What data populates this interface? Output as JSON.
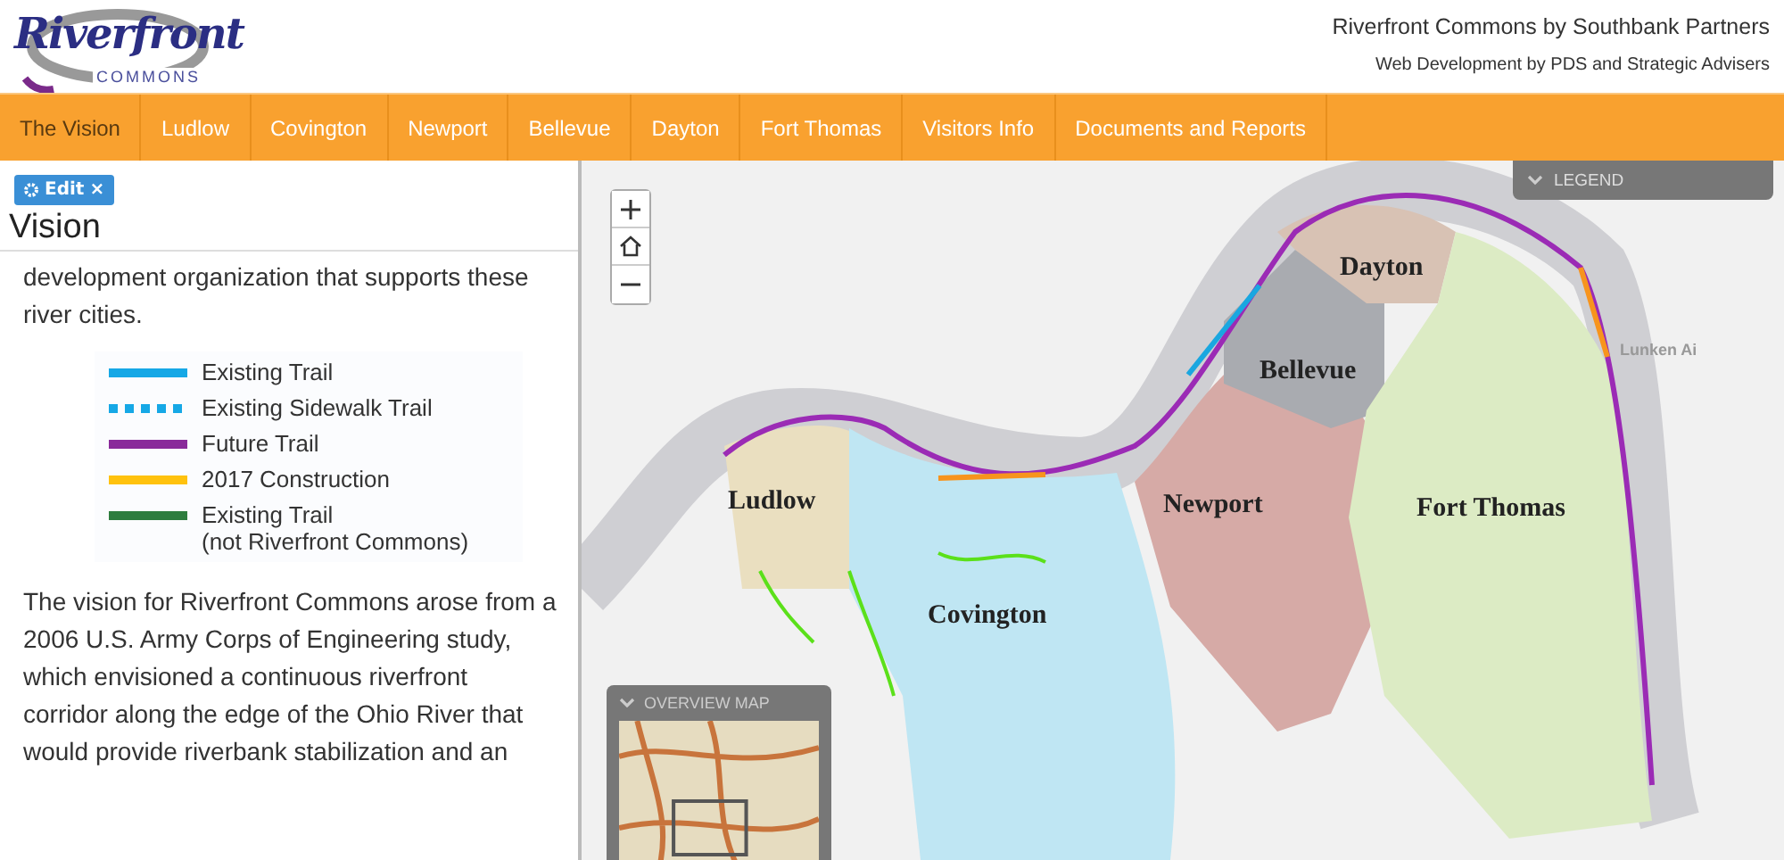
{
  "header": {
    "logo": {
      "script": "Riverfront",
      "sub": "COMMONS"
    },
    "title": "Riverfront Commons by Southbank Partners",
    "credit": "Web Development by PDS and Strategic Advisers"
  },
  "nav": [
    {
      "label": "The Vision",
      "selected": true
    },
    {
      "label": "Ludlow",
      "selected": false
    },
    {
      "label": "Covington",
      "selected": false
    },
    {
      "label": "Newport",
      "selected": false
    },
    {
      "label": "Bellevue",
      "selected": false
    },
    {
      "label": "Dayton",
      "selected": false
    },
    {
      "label": "Fort Thomas",
      "selected": false
    },
    {
      "label": "Visitors Info",
      "selected": false
    },
    {
      "label": "Documents and Reports",
      "selected": false
    }
  ],
  "panel": {
    "edit_button": "Edit",
    "edit_close": "×",
    "title": "Vision",
    "intro": "development organization that supports these river cities.",
    "legend": [
      {
        "kind": "solid",
        "color": "#16a8e6",
        "label": "Existing Trail"
      },
      {
        "kind": "dotted",
        "color": "#16a8e6",
        "label": "Existing Sidewalk Trail"
      },
      {
        "kind": "solid",
        "color": "#8a2a9a",
        "label": "Future Trail"
      },
      {
        "kind": "solid",
        "color": "#ffc20e",
        "label": "2017 Construction"
      },
      {
        "kind": "solid",
        "color": "#2e7d3e",
        "label": "Existing Trail",
        "note": "(not Riverfront Commons)"
      }
    ],
    "body": "The vision for Riverfront Commons arose from a 2006 U.S. Army Corps of Engineering study, which envisioned a continuous riverfront corridor along the edge of the Ohio River that would provide riverbank stabilization and an"
  },
  "map": {
    "legend_panel": "LEGEND",
    "overview_panel": "OVERVIEW MAP",
    "labels": [
      {
        "kind": "city",
        "text": "Ludlow"
      },
      {
        "kind": "city",
        "text": "Covington"
      },
      {
        "kind": "city",
        "text": "Newport"
      },
      {
        "kind": "city",
        "text": "Bellevue"
      },
      {
        "kind": "city",
        "text": "Dayton"
      },
      {
        "kind": "city",
        "text": "Fort Thomas"
      },
      {
        "kind": "place",
        "text": "Lunken Ai"
      }
    ]
  }
}
